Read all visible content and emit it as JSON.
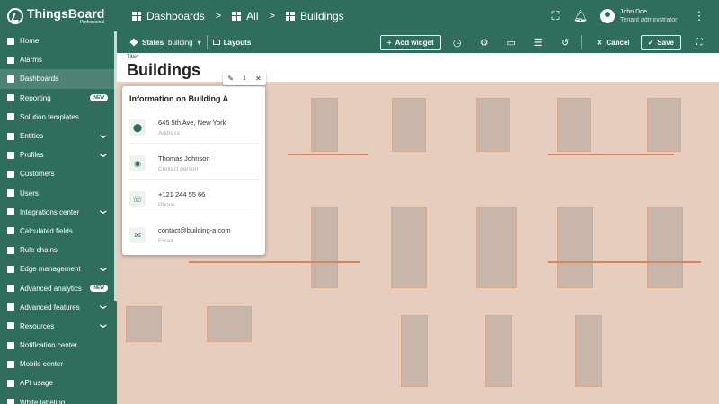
{
  "brand": {
    "name": "ThingsBoard",
    "edition": "Professional"
  },
  "breadcrumb": {
    "root": "Dashboards",
    "sep1": ">",
    "all": "All",
    "sep2": ">",
    "current": "Buildings"
  },
  "user": {
    "name": "John Doe",
    "role": "Tenant administrator"
  },
  "sidebar": {
    "items": [
      {
        "label": "Home",
        "icon": "home-icon"
      },
      {
        "label": "Alarms",
        "icon": "alarm-icon"
      },
      {
        "label": "Dashboards",
        "icon": "dashboard-icon"
      },
      {
        "label": "Reporting",
        "icon": "report-icon",
        "badge": "NEW"
      },
      {
        "label": "Solution templates",
        "icon": "templates-icon"
      },
      {
        "label": "Entities",
        "icon": "entities-icon",
        "expandable": true
      },
      {
        "label": "Profiles",
        "icon": "profiles-icon",
        "expandable": true
      },
      {
        "label": "Customers",
        "icon": "customers-icon"
      },
      {
        "label": "Users",
        "icon": "users-icon"
      },
      {
        "label": "Integrations center",
        "icon": "integrations-icon",
        "expandable": true
      },
      {
        "label": "Calculated fields",
        "icon": "calc-icon"
      },
      {
        "label": "Rule chains",
        "icon": "rule-chains-icon"
      },
      {
        "label": "Edge management",
        "icon": "edge-icon",
        "expandable": true
      },
      {
        "label": "Advanced analytics",
        "icon": "analytics-icon",
        "badge": "NEW"
      },
      {
        "label": "Advanced features",
        "icon": "features-icon",
        "expandable": true
      },
      {
        "label": "Resources",
        "icon": "resources-icon",
        "expandable": true
      },
      {
        "label": "Notification center",
        "icon": "notification-icon"
      },
      {
        "label": "Mobile center",
        "icon": "mobile-icon"
      },
      {
        "label": "API usage",
        "icon": "api-icon"
      },
      {
        "label": "White labeling",
        "icon": "white-label-icon"
      }
    ]
  },
  "toolbar": {
    "states_label": "States",
    "state_value": "building",
    "layouts_label": "Layouts",
    "add_widget": "Add widget",
    "cancel": "Cancel",
    "save": "Save"
  },
  "dashboard": {
    "title_caption": "Title*",
    "title": "Buildings"
  },
  "info_card": {
    "title": "Information on Building A",
    "rows": [
      {
        "value": "645 5th Ave, New York",
        "label": "Address",
        "icon": "location-icon"
      },
      {
        "value": "Thomas Johnson",
        "label": "Contact person",
        "icon": "person-icon"
      },
      {
        "value": "+121 244 55 66",
        "label": "Phone",
        "icon": "phone-icon"
      },
      {
        "value": "contact@building-a.com",
        "label": "Email",
        "icon": "email-icon"
      }
    ]
  },
  "colors": {
    "primary": "#2f6e5d",
    "accent": "#ffffff"
  }
}
